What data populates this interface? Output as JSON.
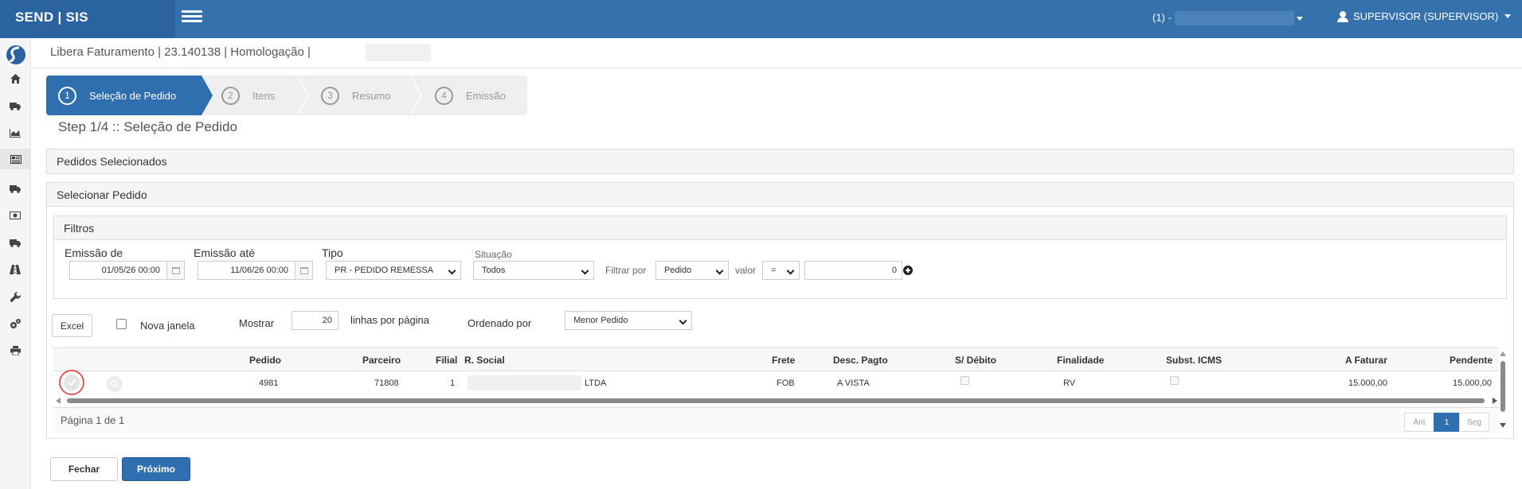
{
  "topbar": {
    "brand": "SEND | SIS",
    "company_prefix": "(1) -",
    "user_label": "SUPERVISOR (SUPERVISOR)"
  },
  "sidebar": {
    "items": [
      {
        "name": "home-icon"
      },
      {
        "name": "truck-icon"
      },
      {
        "name": "area-chart-icon"
      },
      {
        "name": "newspaper-icon",
        "active": true
      },
      {
        "name": "truck-icon"
      },
      {
        "name": "money-icon"
      },
      {
        "name": "truck-icon"
      },
      {
        "name": "road-icon"
      },
      {
        "name": "wrench-icon"
      },
      {
        "name": "gears-icon"
      },
      {
        "name": "print-icon"
      }
    ]
  },
  "page_header": {
    "text": "Libera Faturamento | 23.140138 | Homologação |"
  },
  "wizard": {
    "steps": [
      {
        "number": "1",
        "label": "Seleção de Pedido",
        "active": true
      },
      {
        "number": "2",
        "label": "Itens"
      },
      {
        "number": "3",
        "label": "Resumo"
      },
      {
        "number": "4",
        "label": "Emissão"
      }
    ]
  },
  "step_title": "Step 1/4 :: Seleção de Pedido",
  "selected_panel": {
    "title": "Pedidos Selecionados"
  },
  "select_panel": {
    "title": "Selecionar Pedido"
  },
  "filters": {
    "title": "Filtros",
    "emissao_de": {
      "label": "Emissão de",
      "value": "01/05/26 00:00"
    },
    "emissao_ate": {
      "label": "Emissão até",
      "value": "11/06/26 00:00"
    },
    "tipo": {
      "label": "Tipo",
      "value": "PR - PEDIDO REMESSA"
    },
    "situacao": {
      "label": "Situação",
      "value": "Todos"
    },
    "filtrar_por": {
      "label": "Filtrar por",
      "value": "Pedido"
    },
    "valor": {
      "label": "valor",
      "operator": "=",
      "value": "0"
    }
  },
  "toolbar": {
    "excel_label": "Excel",
    "nova_janela_label": "Nova janela",
    "mostrar_label": "Mostrar",
    "rows_per_page": "20",
    "linhas_label": "linhas por página",
    "ordenado_label": "Ordenado por",
    "ordenado_value": "Menor Pedido"
  },
  "table": {
    "columns": {
      "pedido": "Pedido",
      "parceiro": "Parceiro",
      "filial": "Filial",
      "razao_social": "R. Social",
      "frete": "Frete",
      "desc_pagto": "Desc. Pagto",
      "s_debito": "S/ Débito",
      "finalidade": "Finalidade",
      "subst_icms": "Subst. ICMS",
      "a_faturar": "A Faturar",
      "pendente": "Pendente"
    },
    "rows": [
      {
        "pedido": "4981",
        "parceiro": "71808",
        "filial": "1",
        "razao_social": "LTDA",
        "frete": "FOB",
        "desc_pagto": "A VISTA",
        "finalidade": "RV",
        "a_faturar": "15.000,00",
        "pendente": "15.000,00"
      }
    ],
    "footer": "Página 1 de 1",
    "pager": {
      "prev": "Ant",
      "current": "1",
      "next": "Seg"
    }
  },
  "actions": {
    "close_label": "Fechar",
    "next_label": "Próximo"
  },
  "colors": {
    "topbar": "#3471ad",
    "primary": "#2f6fb0",
    "highlight_ring": "#d9302c"
  }
}
